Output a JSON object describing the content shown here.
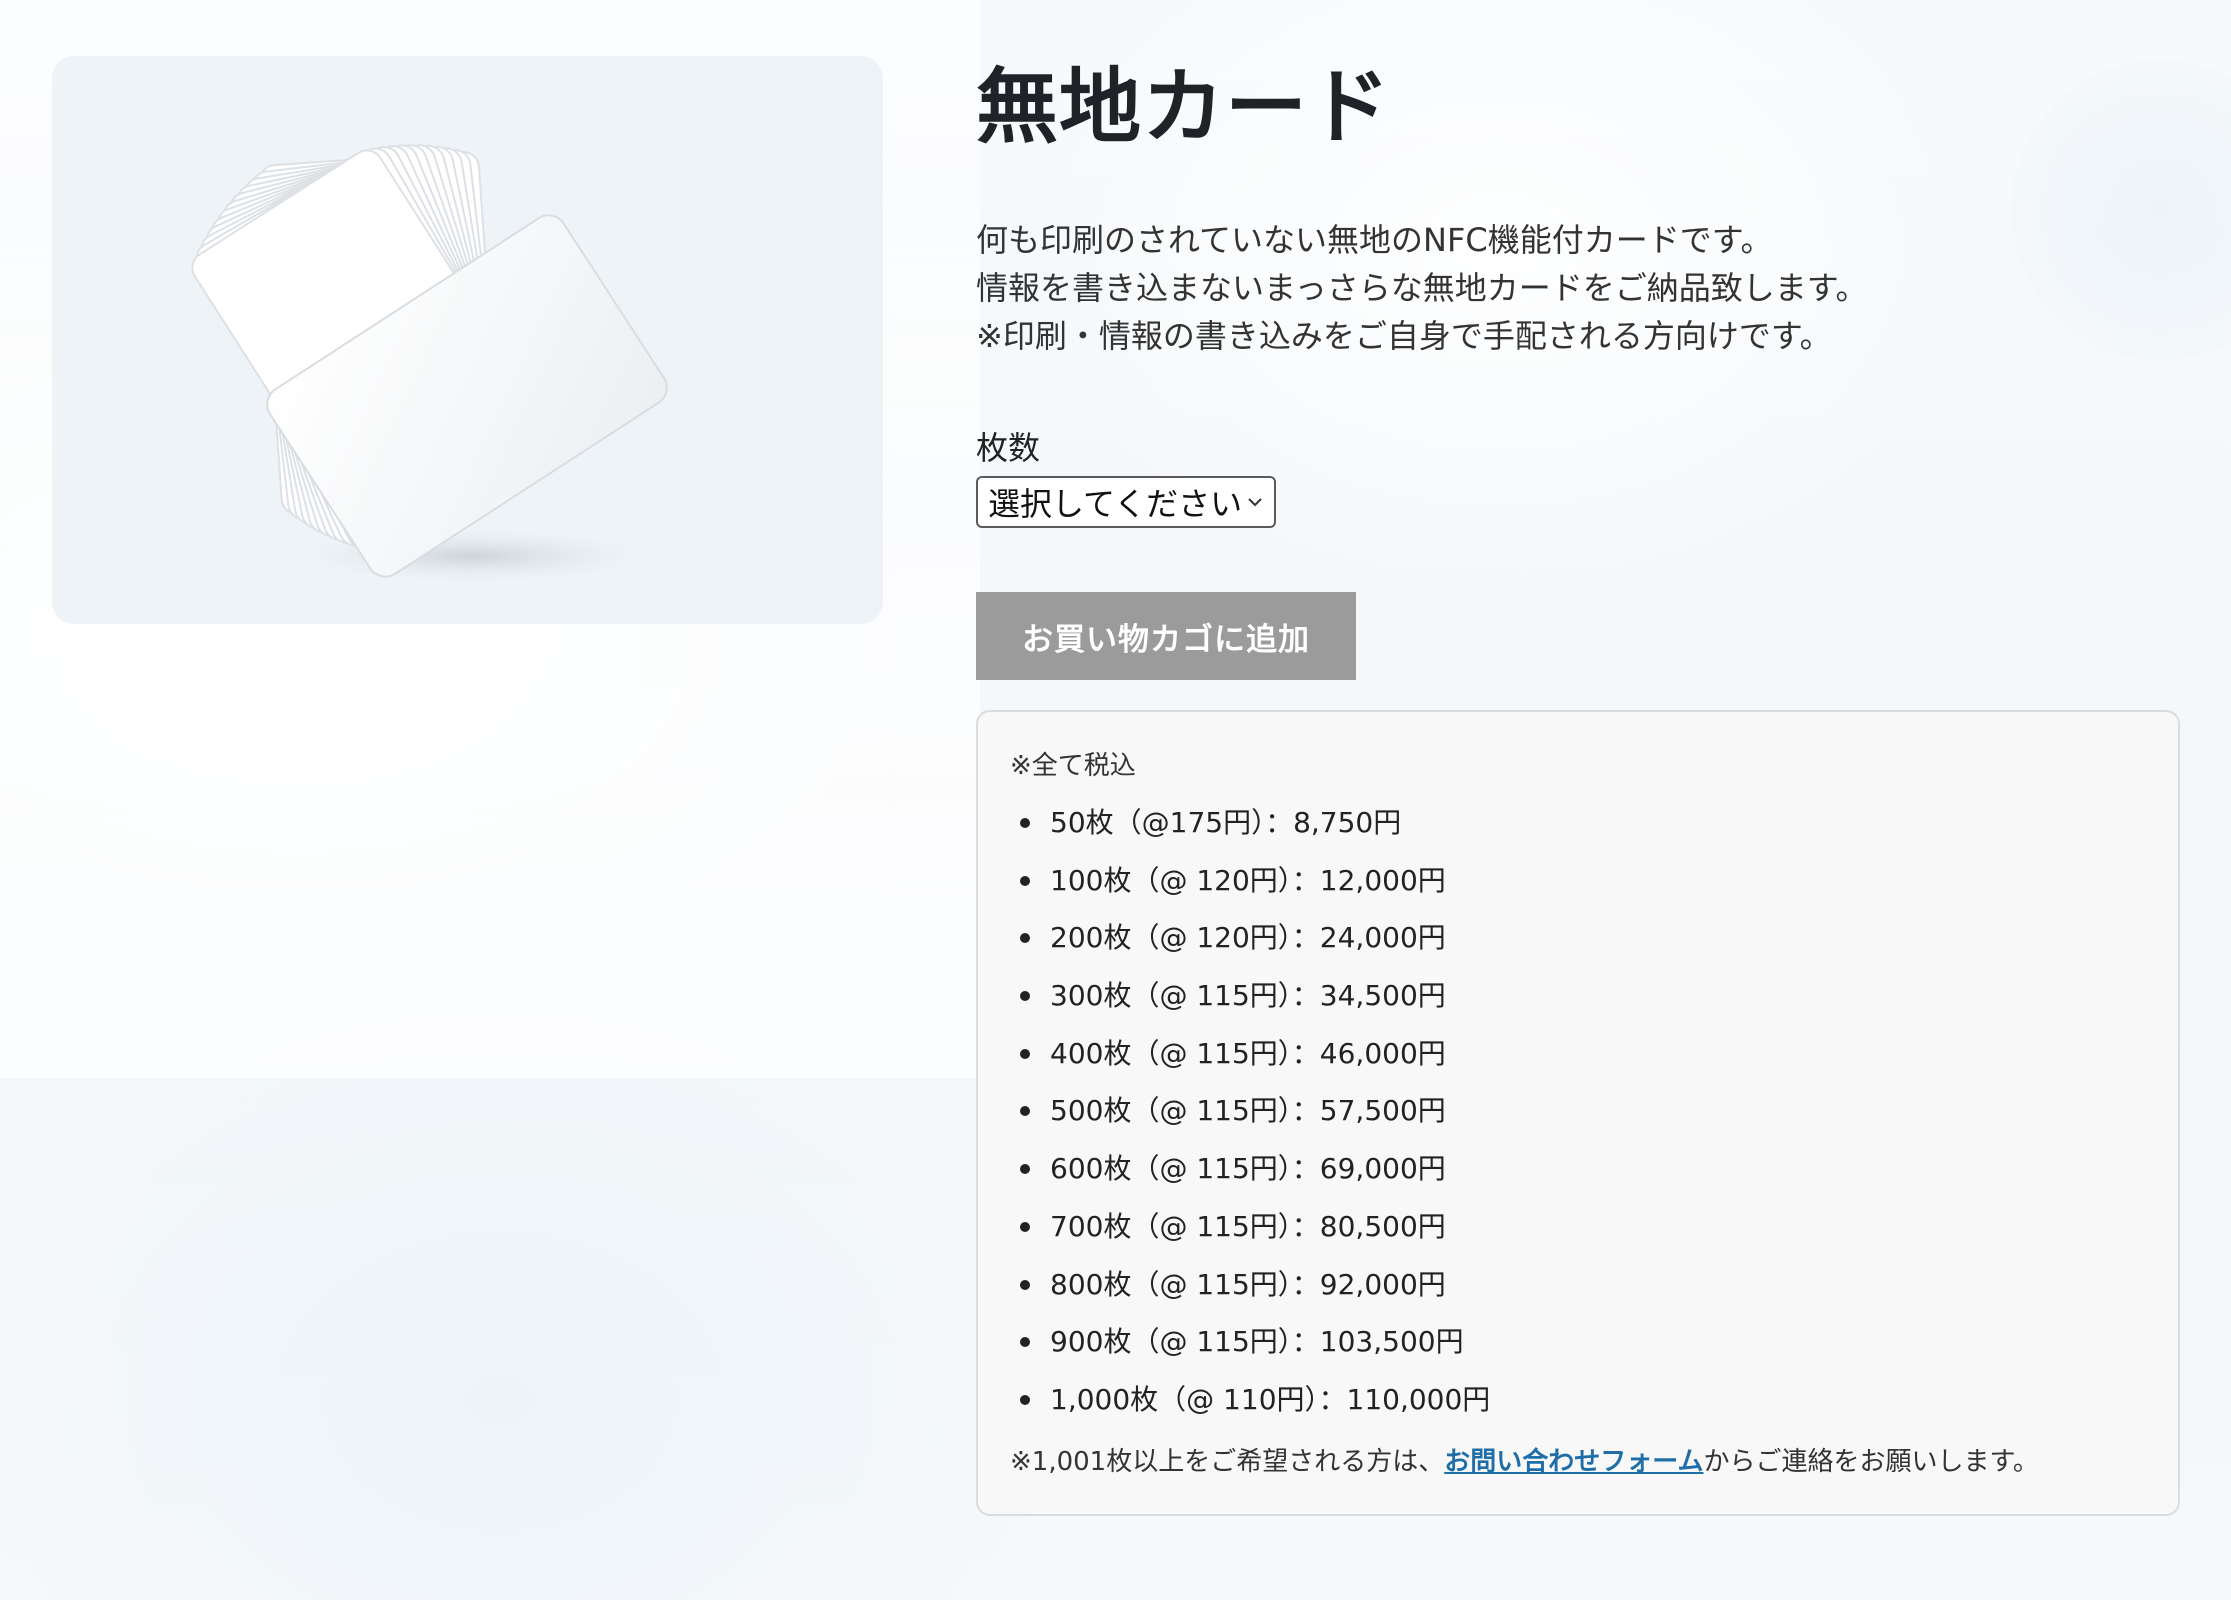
{
  "product": {
    "title": "無地カード",
    "description": [
      "何も印刷のされていない無地のNFC機能付カードです。",
      "情報を書き込まないまっさらな無地カードをご納品致します。",
      "※印刷・情報の書き込みをご自身で手配される方向けです。"
    ],
    "image_icon": "blank-card-stack"
  },
  "quantity": {
    "label": "枚数",
    "selected": "選択してください"
  },
  "cart": {
    "button_label": "お買い物カゴに追加",
    "button_color": "#9b9b9b"
  },
  "pricing": {
    "tax_note": "※全て税込",
    "items": [
      "50枚（@175円）：8,750円",
      "100枚（@ 120円）：12,000円",
      "200枚（@ 120円）：24,000円",
      "300枚（@ 115円）：34,500円",
      "400枚（@ 115円）：46,000円",
      "500枚（@ 115円）：57,500円",
      "600枚（@ 115円）：69,000円",
      "700枚（@ 115円）：80,500円",
      "800枚（@ 115円）：92,000円",
      "900枚（@ 115円）：103,500円",
      "1,000枚（@ 110円）：110,000円"
    ],
    "contact_note_before": "※1,001枚以上をご希望される方は、",
    "contact_link": "お問い合わせフォーム",
    "contact_note_after": "からご連絡をお願いします。",
    "link_color": "#1f6ea8"
  }
}
